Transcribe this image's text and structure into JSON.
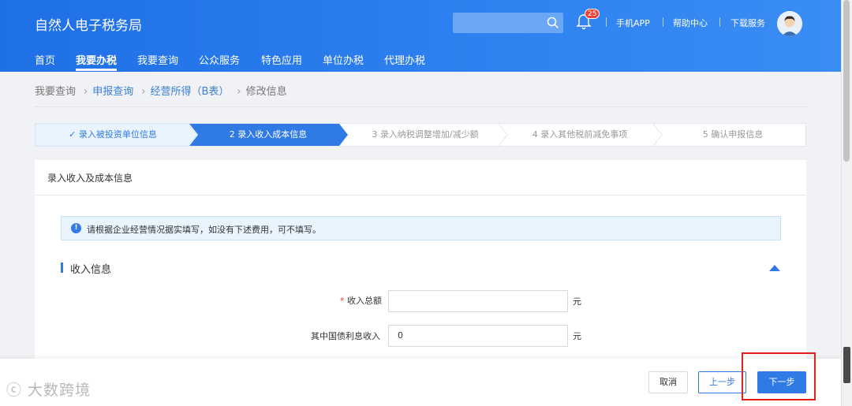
{
  "header": {
    "title": "自然人电子税务局",
    "notification_count": "25",
    "links": [
      "手机APP",
      "帮助中心",
      "下载服务"
    ]
  },
  "nav": {
    "items": [
      "首页",
      "我要办税",
      "我要查询",
      "公众服务",
      "特色应用",
      "单位办税",
      "代理办税"
    ],
    "active": "我要办税"
  },
  "breadcrumb": [
    "我要查询",
    "申报查询",
    "经营所得（B表）",
    "修改信息"
  ],
  "steps": [
    {
      "label": "✓ 录入被投资单位信息",
      "status": "done"
    },
    {
      "label": "2 录入收入成本信息",
      "status": "active"
    },
    {
      "label": "3 录入纳税调整增加/减少额",
      "status": "pending"
    },
    {
      "label": "4 录入其他税前减免事项",
      "status": "pending"
    },
    {
      "label": "5 确认申报信息",
      "status": "pending"
    }
  ],
  "card": {
    "title": "录入收入及成本信息",
    "notice": "请根据企业经营情况据实填写，如没有下述费用，可不填写。",
    "section_title": "收入信息"
  },
  "fields": [
    {
      "label": "收入总额",
      "required": true,
      "value": "",
      "unit": "元"
    },
    {
      "label": "其中国债利息收入",
      "required": false,
      "value": "0",
      "unit": "元"
    }
  ],
  "footer": {
    "cancel": "取消",
    "prev": "上一步",
    "next": "下一步",
    "watermark": "大数跨境"
  },
  "colors": {
    "primary": "#2f7ae5",
    "header_start": "#1f6fe6",
    "header_end": "#3a8df4",
    "highlight": "#e3201b"
  }
}
